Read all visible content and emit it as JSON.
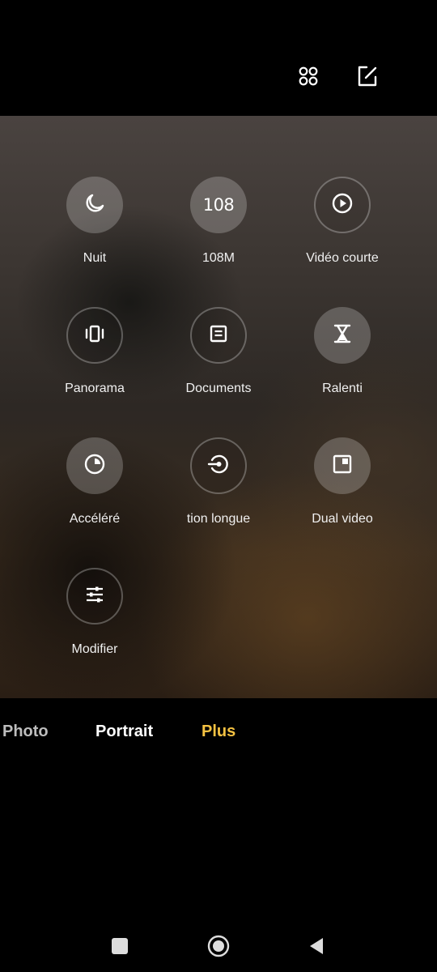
{
  "top_bar": {
    "grid_icon": "grid-icon",
    "edit_icon": "edit-icon"
  },
  "modes": [
    {
      "label": "Nuit",
      "icon": "moon-icon",
      "style": "filled"
    },
    {
      "label": "108M",
      "icon": "108-text-icon",
      "icon_text": "108",
      "style": "filled"
    },
    {
      "label": "Vidéo courte",
      "icon": "play-icon",
      "style": "outlined"
    },
    {
      "label": "Panorama",
      "icon": "panorama-icon",
      "style": "outlined"
    },
    {
      "label": "Documents",
      "icon": "document-icon",
      "style": "outlined"
    },
    {
      "label": "Ralenti",
      "icon": "hourglass-icon",
      "style": "filled"
    },
    {
      "label": "Accéléré",
      "icon": "timelapse-icon",
      "style": "filled"
    },
    {
      "label": "tion longue",
      "icon": "long-exposure-icon",
      "style": "outlined"
    },
    {
      "label": "Dual video",
      "icon": "dual-video-icon",
      "style": "filled"
    },
    {
      "label": "Modifier",
      "icon": "sliders-icon",
      "style": "outlined"
    }
  ],
  "tabs": {
    "photo": "Photo",
    "portrait": "Portrait",
    "plus": "Plus",
    "active": "Plus",
    "active_color": "#f5c242"
  },
  "nav": {
    "recents_icon": "square-icon",
    "home_icon": "circle-icon",
    "back_icon": "triangle-back-icon"
  }
}
